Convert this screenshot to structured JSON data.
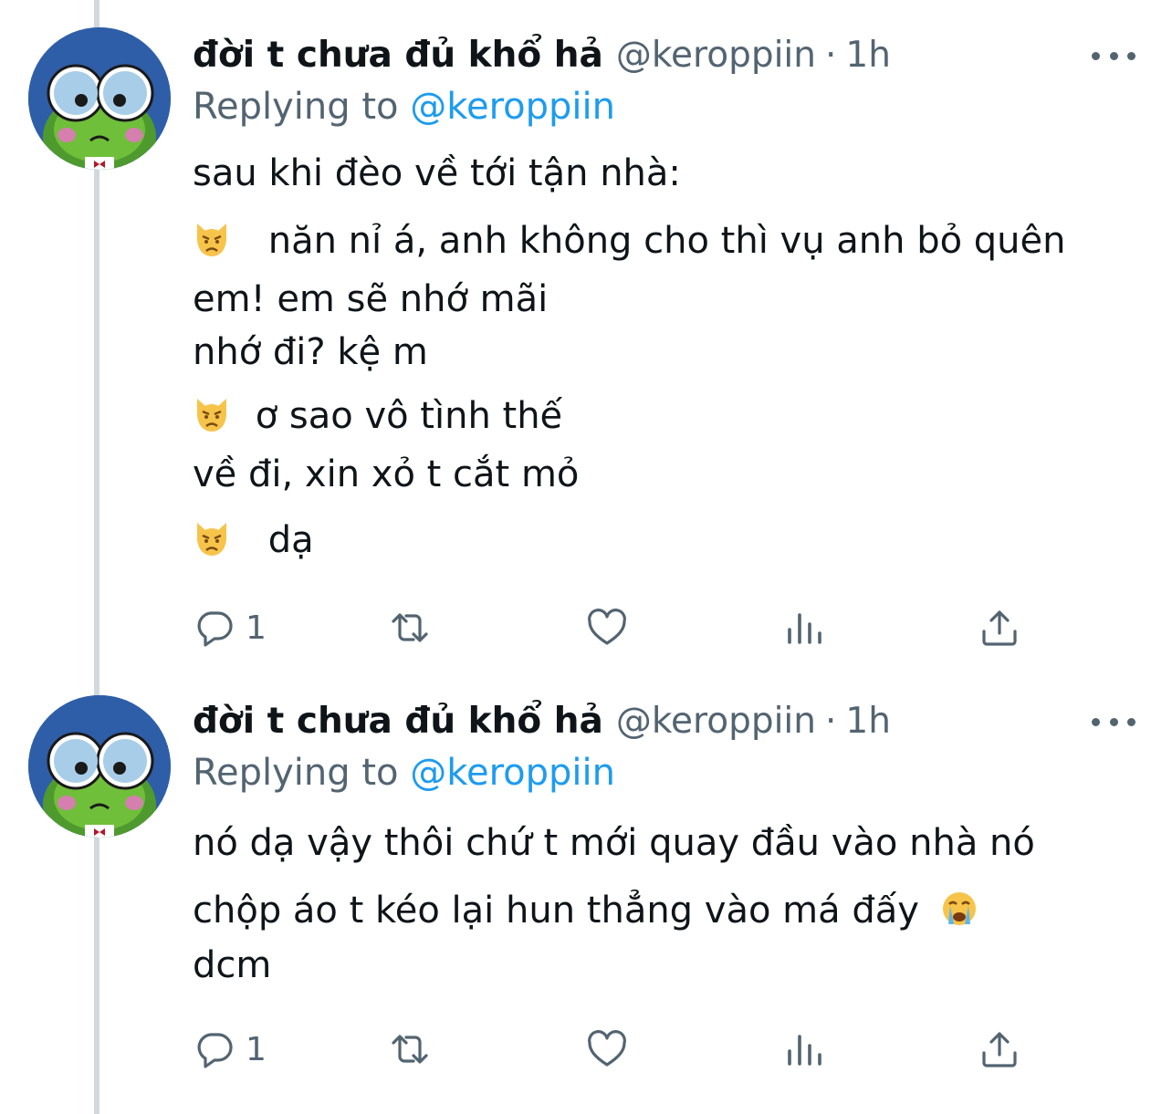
{
  "tweets": [
    {
      "display_name": "đời t chưa đủ khổ hả",
      "handle": "@keroppiin",
      "separator": "·",
      "time": "1h",
      "replying_prefix": "Replying to",
      "replying_to": "@keroppiin",
      "lines": [
        "sau khi đèo về tới tận nhà:",
        "năn nỉ á, anh không cho thì vụ anh bỏ quên",
        "em! em sẽ nhớ mãi",
        "nhớ đi? kệ m",
        "ơ sao vô tình thế",
        "về đi, xin xỏ t cắt mỏ",
        "dạ"
      ],
      "emoji_icons": [
        "pouting-cat-emoji-icon",
        "pouting-cat-emoji-icon",
        "pouting-cat-emoji-icon"
      ],
      "reply_count": "1"
    },
    {
      "display_name": "đời t chưa đủ khổ hả",
      "handle": "@keroppiin",
      "separator": "·",
      "time": "1h",
      "replying_prefix": "Replying to",
      "replying_to": "@keroppiin",
      "lines": [
        "nó dạ vậy thôi chứ t mới quay đầu vào nhà nó",
        "chộp áo t kéo lại hun thẳng vào má đấy",
        "dcm"
      ],
      "emoji_icons": [
        "loudly-crying-face-emoji-icon"
      ],
      "reply_count": "1"
    }
  ],
  "colors": {
    "text": "#0f1419",
    "muted": "#536471",
    "link": "#1d9bf0",
    "thread_line": "#cfd9de"
  },
  "icons": [
    "reply-icon",
    "retweet-icon",
    "like-icon",
    "analytics-icon",
    "share-icon",
    "more-icon"
  ]
}
